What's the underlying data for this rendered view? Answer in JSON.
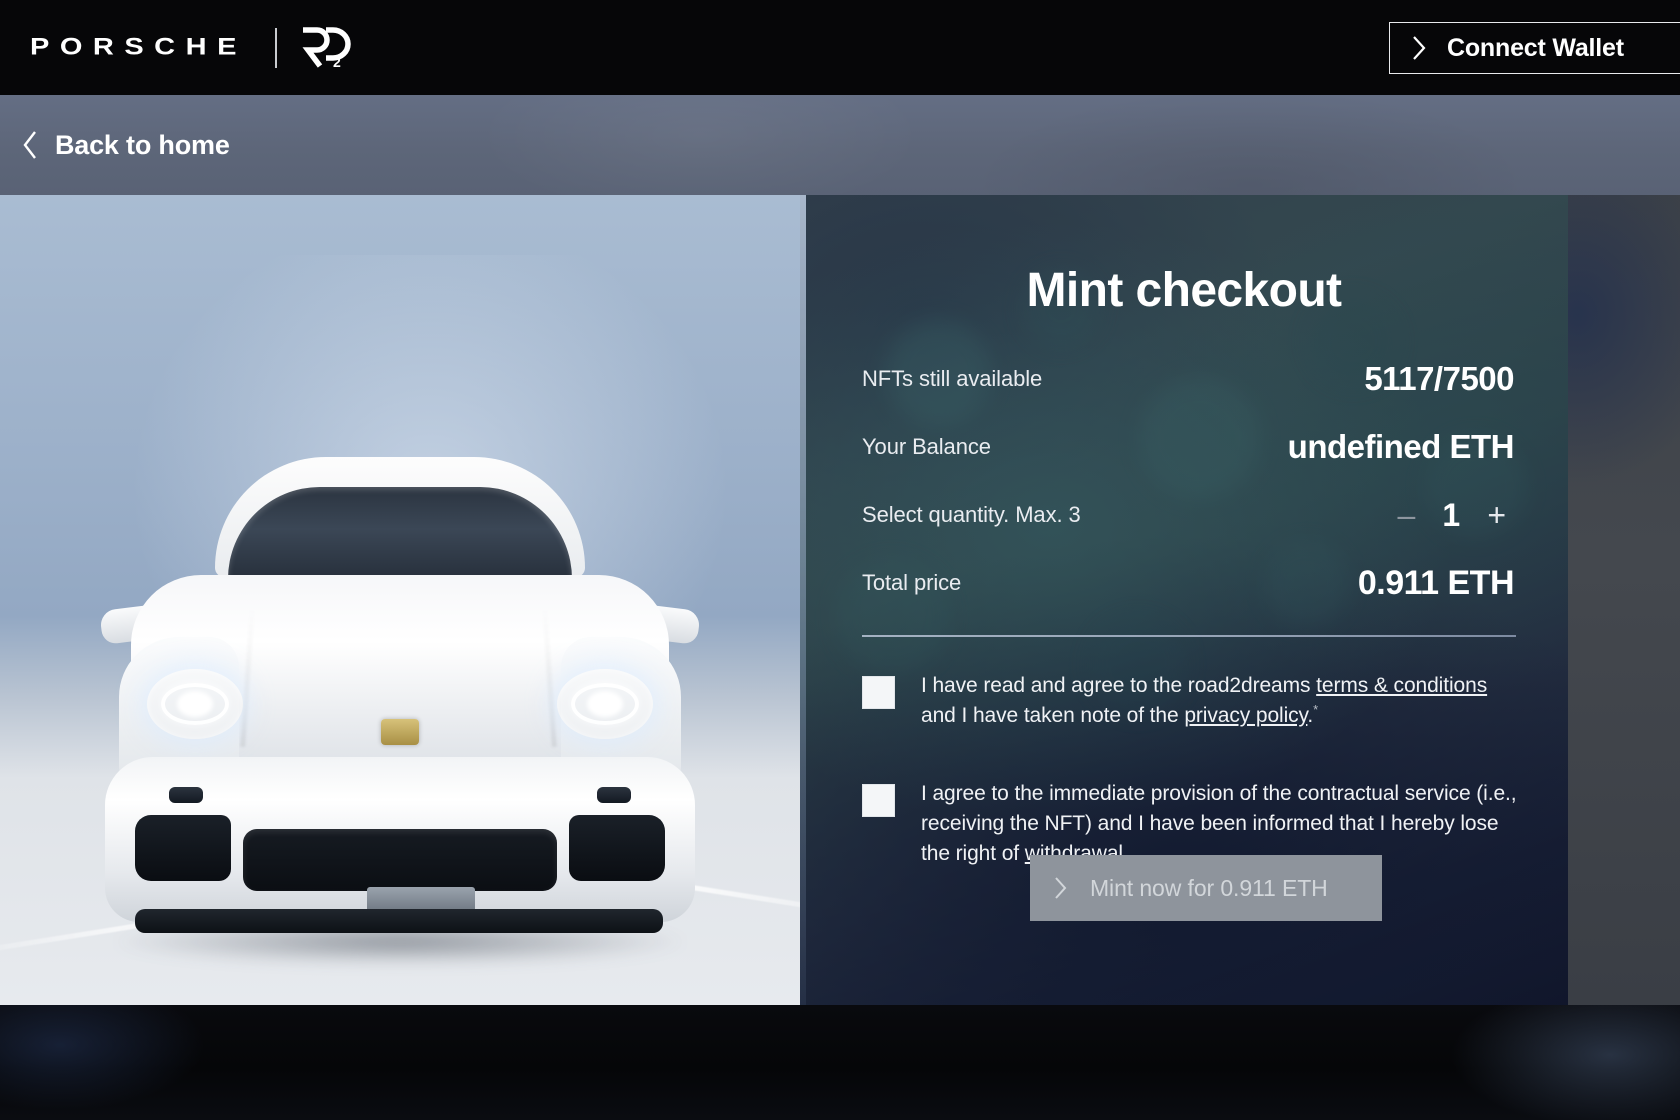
{
  "header": {
    "brand": "PORSCHE",
    "sub_brand_logo": "r2d-logo",
    "connect_wallet_label": "Connect Wallet",
    "connect_wallet_icon": "chevron-right-icon"
  },
  "subnav": {
    "back_label": "Back to home",
    "back_icon": "chevron-left-icon"
  },
  "hero": {
    "image_alt": "porsche-911-front-view"
  },
  "checkout": {
    "title": "Mint checkout",
    "rows": [
      {
        "label": "NFTs still available",
        "value": "5117/7500"
      },
      {
        "label": "Your Balance",
        "value": "undefined ETH"
      },
      {
        "label": "Select quantity. Max. 3",
        "value": "1"
      },
      {
        "label": "Total price",
        "value": "0.911 ETH"
      }
    ],
    "quantity": {
      "label": "Select quantity. Max. 3",
      "decrement_icon": "minus-icon",
      "decrement_symbol": "–",
      "value": "1",
      "increment_icon": "plus-icon",
      "increment_symbol": "+"
    },
    "agreements": [
      {
        "checked": false,
        "text_before": "I have read and agree to the road2dreams ",
        "link1": "terms & conditions",
        "text_middle": " and I have taken note of the ",
        "link2": "privacy policy",
        "text_after": ".",
        "asterisk": "*"
      },
      {
        "checked": false,
        "text_before": "I agree to the immediate provision of the contractual service (i.e., receiving the NFT) and I have been informed that I hereby lose the right of ",
        "link1": "withdrawal",
        "text_after": "."
      }
    ],
    "mint_button": {
      "label": "Mint now for 0.911 ETH",
      "icon": "chevron-right-icon",
      "disabled": true
    }
  },
  "colors": {
    "topbar_bg": "#060608",
    "subbar_bg": "#5d6679",
    "panel_teal": "#33484f",
    "panel_navy": "#10152a",
    "button_disabled": "#8e949c",
    "text_primary": "#ffffff"
  }
}
